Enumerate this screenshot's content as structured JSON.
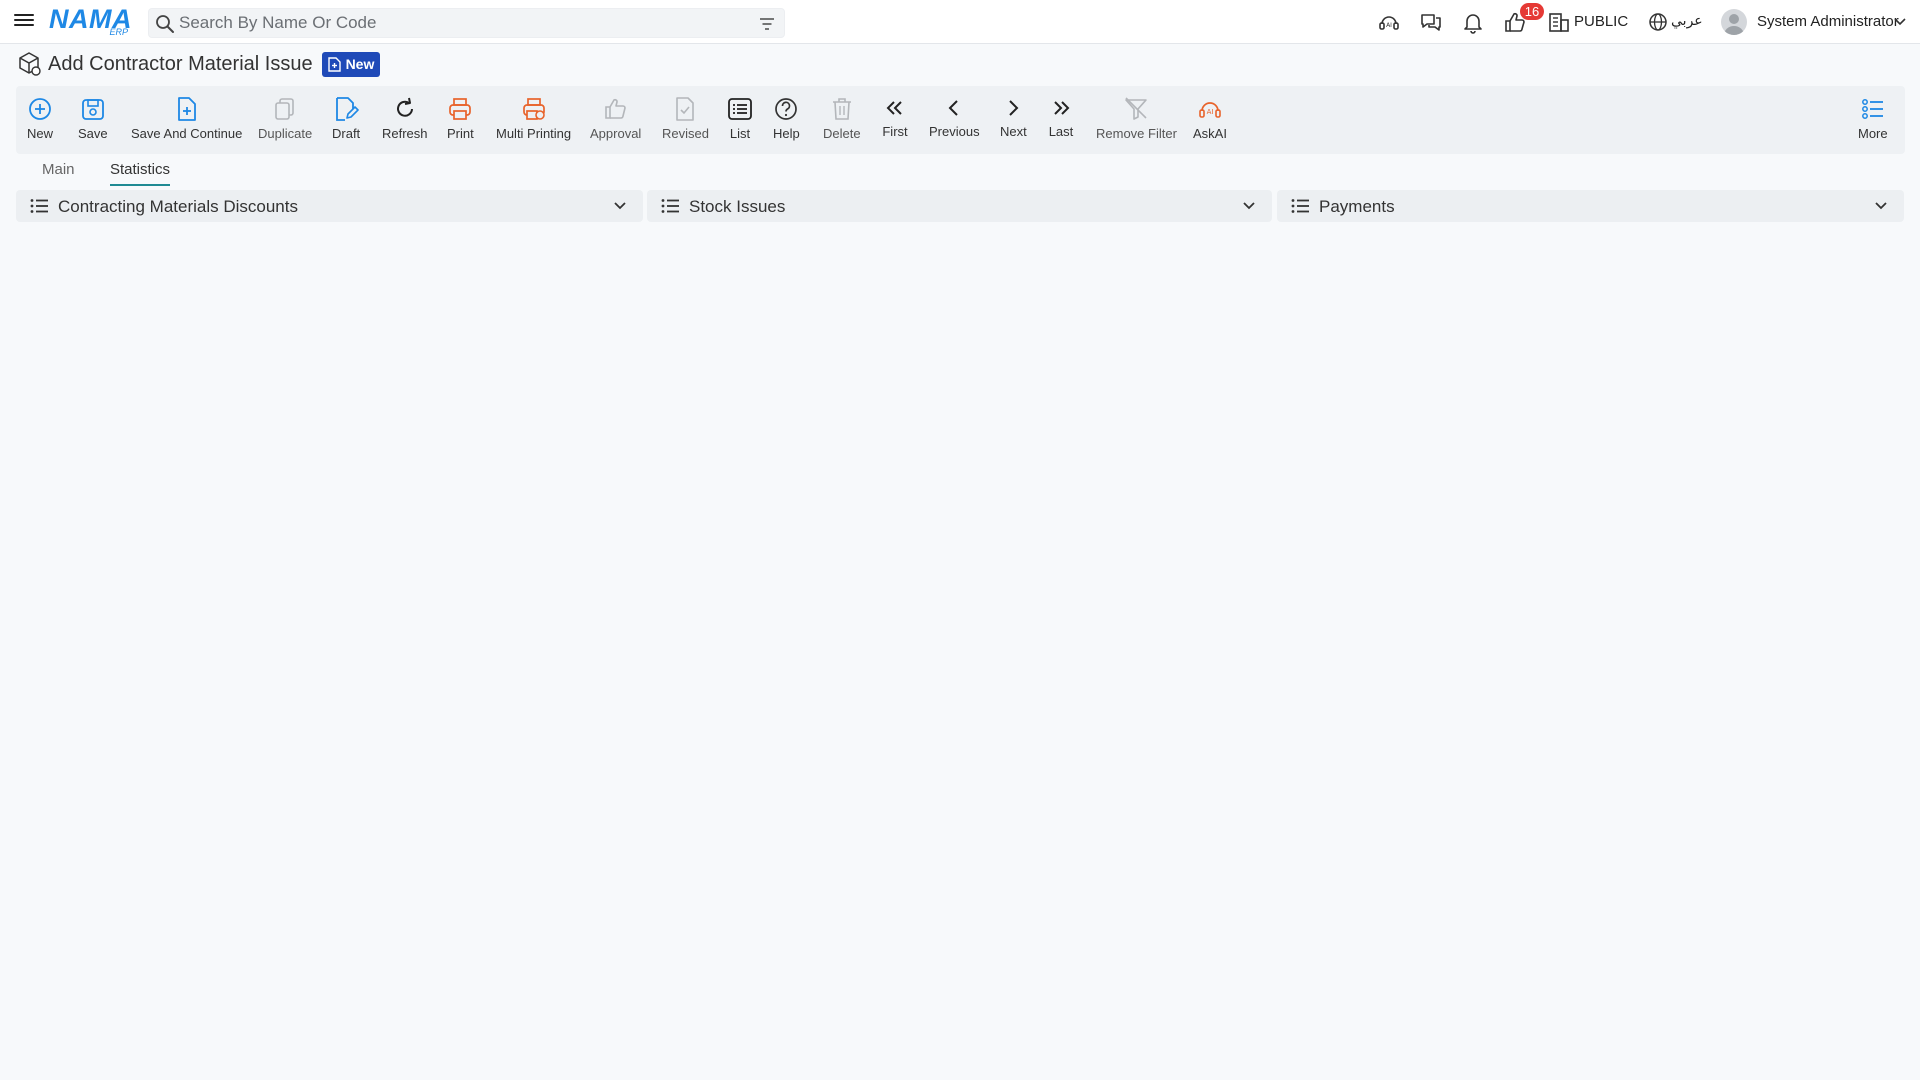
{
  "header": {
    "logo_text": "NAMA",
    "logo_sub": "ERP",
    "search_placeholder": "Search By Name Or Code",
    "notification_count": "16",
    "company": "PUBLIC",
    "language": "عربي",
    "user_name": "System Administrator"
  },
  "page": {
    "title": "Add Contractor Material Issue",
    "status": "New"
  },
  "toolbar": {
    "new": "New",
    "save": "Save",
    "save_continue": "Save And Continue",
    "duplicate": "Duplicate",
    "draft": "Draft",
    "refresh": "Refresh",
    "print": "Print",
    "multi_printing": "Multi Printing",
    "approval": "Approval",
    "revised": "Revised",
    "list": "List",
    "help": "Help",
    "delete": "Delete",
    "first": "First",
    "previous": "Previous",
    "next": "Next",
    "last": "Last",
    "remove_filter": "Remove Filter",
    "askai": "AskAI",
    "more": "More"
  },
  "tabs": {
    "main": "Main",
    "statistics": "Statistics",
    "active": "Statistics"
  },
  "panels": {
    "p1": "Contracting Materials Discounts",
    "p2": "Stock Issues",
    "p3": "Payments"
  },
  "colors": {
    "accent_blue": "#1e88e5",
    "status_pill": "#1f4ab8",
    "print_orange": "#e8632b",
    "badge_red": "#e53935",
    "tab_underline": "#1f8a93"
  }
}
